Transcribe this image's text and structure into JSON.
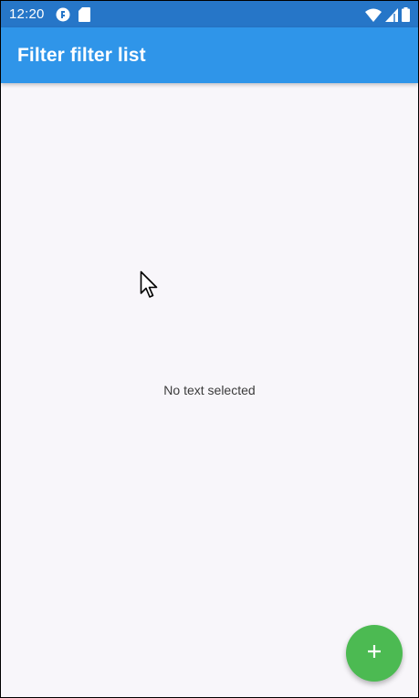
{
  "status_bar": {
    "time": "12:20",
    "left_icons": [
      "app-notification-icon",
      "sd-card-icon"
    ],
    "right_icons": [
      "wifi-icon",
      "cell-signal-icon",
      "battery-icon"
    ]
  },
  "app_bar": {
    "title": "Filter filter list"
  },
  "content": {
    "empty_message": "No text selected"
  },
  "fab": {
    "icon": "plus-icon"
  },
  "colors": {
    "status_bar": "#2676c8",
    "app_bar": "#2f95e9",
    "background": "#f8f6fa",
    "fab": "#4cba52"
  }
}
